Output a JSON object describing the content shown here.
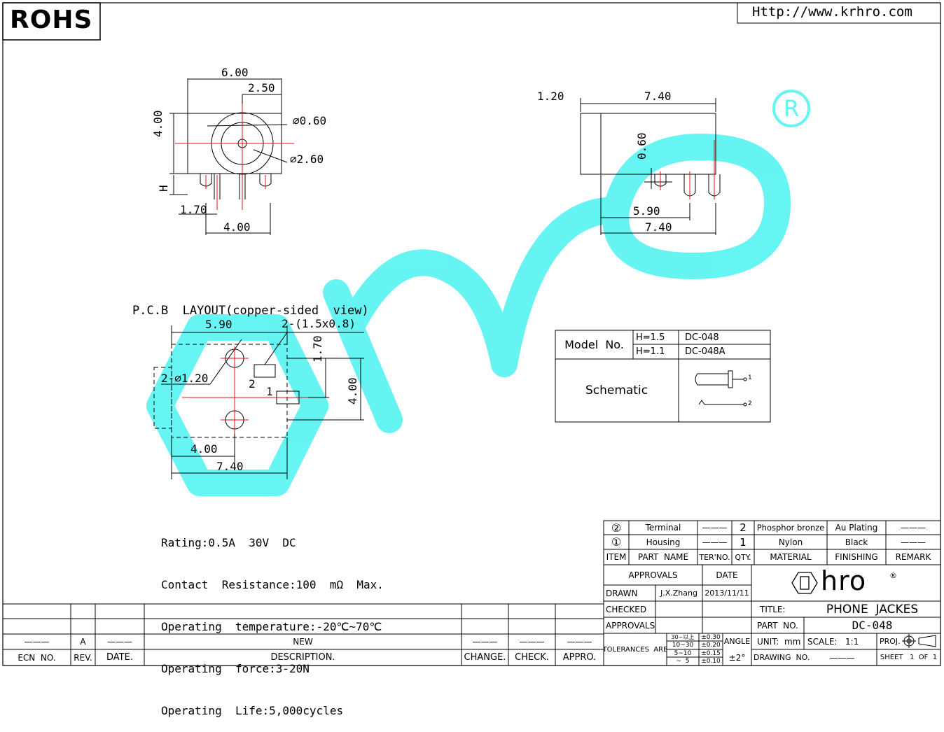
{
  "header": {
    "rohs": "ROHS",
    "website": "Http://www.krhro.com"
  },
  "front_view": {
    "dim_width": "6.00",
    "dim_offset": "2.50",
    "dim_height": "4.00",
    "dim_h": "H",
    "dim_inner": "⌀0.60",
    "dim_outer": "⌀2.60",
    "dim_pin_offset": "1.70",
    "dim_pin_span": "4.00"
  },
  "side_view": {
    "dim_lip": "1.20",
    "dim_length": "7.40",
    "dim_pin": "0.60",
    "dim_pin_pos": "5.90",
    "dim_total": "7.40"
  },
  "pcb_layout": {
    "title": "P.C.B  LAYOUT(copper-sided  view)",
    "dim_590": "5.90",
    "dim_slots": "2-(1.5x0.8)",
    "dim_170": "1.70",
    "dim_holes": "2-⌀1.20",
    "dim_400_v": "4.00",
    "dim_400_h": "4.00",
    "dim_740": "7.40",
    "pad_1": "1",
    "pad_2": "2"
  },
  "model_table": {
    "model_label": "Model  No.",
    "rows": [
      {
        "h": "H=1.5",
        "model": "DC-048"
      },
      {
        "h": "H=1.1",
        "model": "DC-048A"
      }
    ],
    "schematic_label": "Schematic",
    "pin_1": "1",
    "pin_2": "2"
  },
  "specs": [
    "Rating:0.5A  30V  DC",
    "Contact  Resistance:100  mΩ  Max.",
    "Operating  temperature:-20℃~70℃",
    "Operating  force:3-20N",
    "Operating  Life:5,000cycles"
  ],
  "bom": {
    "rows": [
      {
        "item": "②",
        "part": "Terminal",
        "ter": "———",
        "qty": "2",
        "material": "Phosphor bronze",
        "finish": "Au Plating",
        "remark": "———"
      },
      {
        "item": "①",
        "part": "Housing",
        "ter": "———",
        "qty": "1",
        "material": "Nylon",
        "finish": "Black",
        "remark": "———"
      }
    ],
    "headers": {
      "item": "ITEM",
      "part": "PART  NAME",
      "ter": "TER'NO.",
      "qty": "QTY.",
      "material": "MATERIAL",
      "finish": "FINISHING",
      "remark": "REMARK"
    }
  },
  "title_block": {
    "approvals_hdr": "APPROVALS",
    "date_hdr": "DATE",
    "drawn": "DRAWN",
    "drawn_by": "J.X.Zhang",
    "drawn_date": "2013/11/11",
    "checked": "CHECKED",
    "approvals": "APPROVALS",
    "logo_text": "hro",
    "title_label": "TITLE:",
    "title_value": "PHONE  JACKES",
    "part_label": "PART  NO.",
    "part_value": "DC-048",
    "tolerances": "TOLERANCES  ARE",
    "tol_rows": [
      {
        "range": "30~以上",
        "val": "±0.30"
      },
      {
        "range": "10~30",
        "val": "±0.20"
      },
      {
        "range": "5~10",
        "val": "±0.15"
      },
      {
        "range": "~  5",
        "val": "±0.10"
      }
    ],
    "angle_label": "ANGLE",
    "angle_value": "±2°",
    "unit": "UNIT:  mm",
    "scale": "SCALE:   1:1",
    "proj": "PROJ.",
    "drawing_no": "DRAWING  NO.",
    "drawing_no_value": "———",
    "sheet": "SHEET   1  OF  1"
  },
  "revision": {
    "ecn": "ECN  NO.",
    "rev": "REV.",
    "date": "DATE.",
    "desc": "DESCRIPTION.",
    "change": "CHANGE.",
    "check": "CHECK.",
    "appro": "APPRO.",
    "row_ecn": "———",
    "row_rev": "A",
    "row_date": "———",
    "row_desc": "NEW",
    "row_change": "———",
    "row_check": "———",
    "row_appro": "———"
  },
  "colors": {
    "watermark": "#5ef4f2",
    "centerline": "#e01010",
    "line": "#000000"
  }
}
